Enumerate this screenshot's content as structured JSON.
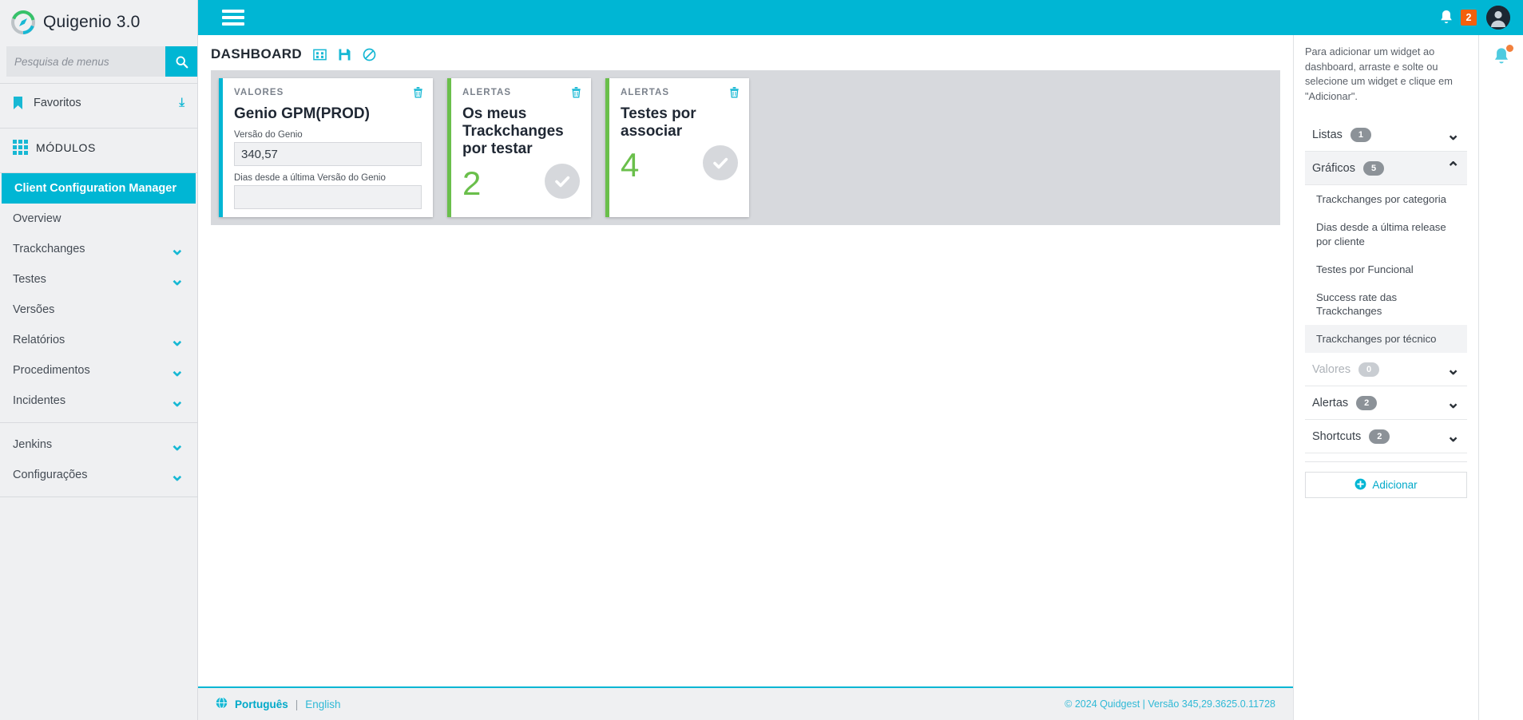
{
  "brand": {
    "title": "Quigenio 3.0",
    "logo_icon": "compass-logo-icon"
  },
  "search": {
    "placeholder": "Pesquisa de menus",
    "value": "",
    "icon": "search-icon"
  },
  "sidebar": {
    "favorites": {
      "label": "Favoritos",
      "icon": "bookmark-icon",
      "chevron": "chevron-down-icon"
    },
    "modules": {
      "label": "MÓDULOS",
      "icon": "grid-icon"
    },
    "active_module": "Client Configuration Manager",
    "items": [
      {
        "label": "Overview",
        "expandable": false
      },
      {
        "label": "Trackchanges",
        "expandable": true
      },
      {
        "label": "Testes",
        "expandable": true
      },
      {
        "label": "Versões",
        "expandable": false
      },
      {
        "label": "Relatórios",
        "expandable": true
      },
      {
        "label": "Procedimentos",
        "expandable": true
      },
      {
        "label": "Incidentes",
        "expandable": true
      }
    ],
    "items_bottom": [
      {
        "label": "Jenkins",
        "expandable": true
      },
      {
        "label": "Configurações",
        "expandable": true
      }
    ]
  },
  "topbar": {
    "menu_icon": "hamburger-icon",
    "bell_icon": "bell-icon",
    "notification_count": "2",
    "avatar_icon": "user-avatar-icon"
  },
  "page": {
    "title": "DASHBOARD",
    "actions": [
      {
        "name": "widgets-layout-icon",
        "title": "Widgets"
      },
      {
        "name": "save-icon",
        "title": "Guardar"
      },
      {
        "name": "cancel-icon",
        "title": "Cancelar"
      }
    ]
  },
  "widgets": [
    {
      "kicker": "VALORES",
      "title": "Genio GPM(PROD)",
      "accent": "#00b6d4",
      "type": "values",
      "trash_icon": "trash-icon",
      "fields": [
        {
          "label": "Versão do Genio",
          "value": "340,57"
        },
        {
          "label": "Dias desde a última Versão do Genio",
          "value": ""
        }
      ]
    },
    {
      "kicker": "ALERTAS",
      "title": "Os meus Trackchanges por testar",
      "accent": "#6abf4b",
      "type": "alert",
      "count": "2",
      "trash_icon": "trash-icon",
      "status_icon": "check-circle-icon"
    },
    {
      "kicker": "ALERTAS",
      "title": "Testes por associar",
      "accent": "#6abf4b",
      "type": "alert",
      "count": "4",
      "trash_icon": "trash-icon",
      "status_icon": "check-circle-icon"
    }
  ],
  "right_panel": {
    "help_text": "Para adicionar um widget ao dashboard, arraste e solte ou selecione um widget e clique em \"Adicionar\".",
    "groups": [
      {
        "label": "Listas",
        "count": "1",
        "expanded": false,
        "dim": false,
        "items": []
      },
      {
        "label": "Gráficos",
        "count": "5",
        "expanded": true,
        "dim": false,
        "items": [
          {
            "label": "Trackchanges por categoria",
            "selected": false
          },
          {
            "label": "Dias desde a última release por cliente",
            "selected": false
          },
          {
            "label": "Testes por Funcional",
            "selected": false
          },
          {
            "label": "Success rate das Trackchanges",
            "selected": false
          },
          {
            "label": "Trackchanges por técnico",
            "selected": true
          }
        ]
      },
      {
        "label": "Valores",
        "count": "0",
        "expanded": false,
        "dim": true,
        "items": []
      },
      {
        "label": "Alertas",
        "count": "2",
        "expanded": false,
        "dim": false,
        "items": []
      },
      {
        "label": "Shortcuts",
        "count": "2",
        "expanded": false,
        "dim": false,
        "items": []
      }
    ],
    "add_label": "Adicionar",
    "add_icon": "plus-circle-icon"
  },
  "rail": {
    "bell_icon": "bell-notification-icon"
  },
  "footer": {
    "globe_icon": "globe-icon",
    "lang_active": "Português",
    "lang_sep": "|",
    "lang_other": "English",
    "copyright": "© 2024 Quidgest | Versão 345,29.3625.0.11728"
  },
  "colors": {
    "accent": "#00b6d4",
    "green": "#6abf4b",
    "badge_orange": "#f2600c"
  }
}
